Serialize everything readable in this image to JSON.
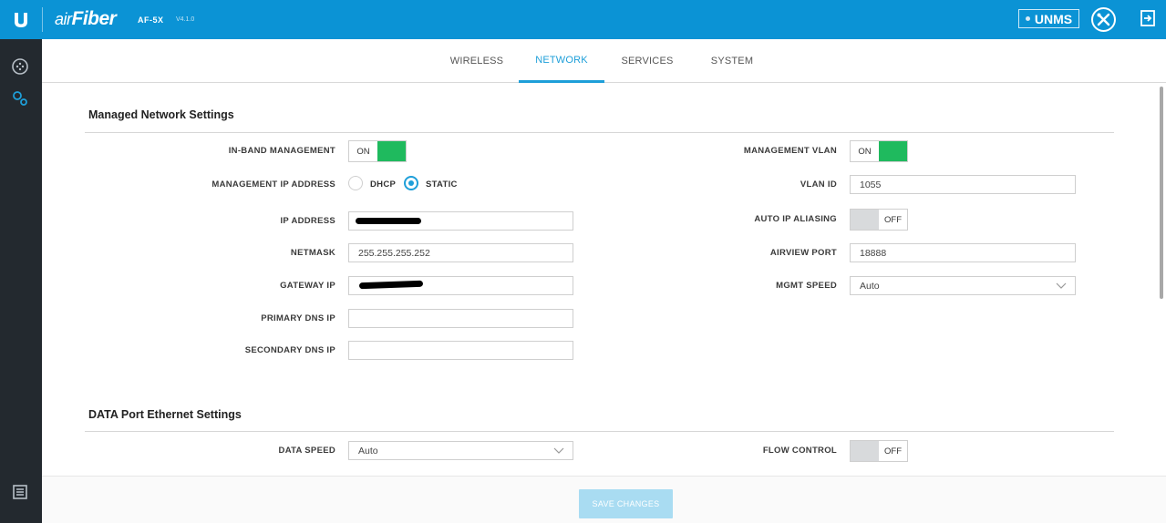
{
  "header": {
    "logo_letter": "U",
    "brand_prefix": "air",
    "brand_name": "Fiber",
    "model": "AF-5X",
    "version": "V4.1.0",
    "unms_label": "UNMS",
    "brand_color": "#0b93d5"
  },
  "sidebar": {
    "icons": [
      "dashboard-icon",
      "settings-gears-icon",
      "log-icon"
    ]
  },
  "tabs": [
    {
      "label": "WIRELESS",
      "active": false
    },
    {
      "label": "NETWORK",
      "active": true
    },
    {
      "label": "SERVICES",
      "active": false
    },
    {
      "label": "SYSTEM",
      "active": false
    }
  ],
  "managed": {
    "title": "Managed Network Settings",
    "in_band_management": {
      "label": "IN-BAND MANAGEMENT",
      "state": "ON"
    },
    "management_ip": {
      "label": "MANAGEMENT IP ADDRESS",
      "options": [
        "DHCP",
        "STATIC"
      ],
      "selected": "STATIC"
    },
    "ip_address": {
      "label": "IP ADDRESS",
      "value": ""
    },
    "netmask": {
      "label": "NETMASK",
      "value": "255.255.255.252"
    },
    "gateway_ip": {
      "label": "GATEWAY IP",
      "value": ""
    },
    "primary_dns": {
      "label": "PRIMARY DNS IP",
      "value": ""
    },
    "secondary_dns": {
      "label": "SECONDARY DNS IP",
      "value": ""
    },
    "management_vlan": {
      "label": "MANAGEMENT VLAN",
      "state": "ON"
    },
    "vlan_id": {
      "label": "VLAN ID",
      "value": "1055"
    },
    "auto_ip_aliasing": {
      "label": "AUTO IP ALIASING",
      "state": "OFF"
    },
    "airview_port": {
      "label": "AIRVIEW PORT",
      "value": "18888"
    },
    "mgmt_speed": {
      "label": "MGMT SPEED",
      "value": "Auto"
    }
  },
  "data_port": {
    "title": "DATA Port Ethernet Settings",
    "data_speed": {
      "label": "DATA SPEED",
      "value": "Auto"
    },
    "flow_control": {
      "label": "FLOW CONTROL",
      "state": "OFF"
    }
  },
  "footer": {
    "save_label": "SAVE CHANGES"
  },
  "colors": {
    "accent": "#1e9fd9",
    "toggle_on": "#1fba5e",
    "toggle_off": "#d8dadc",
    "sidebar": "#23292f"
  }
}
